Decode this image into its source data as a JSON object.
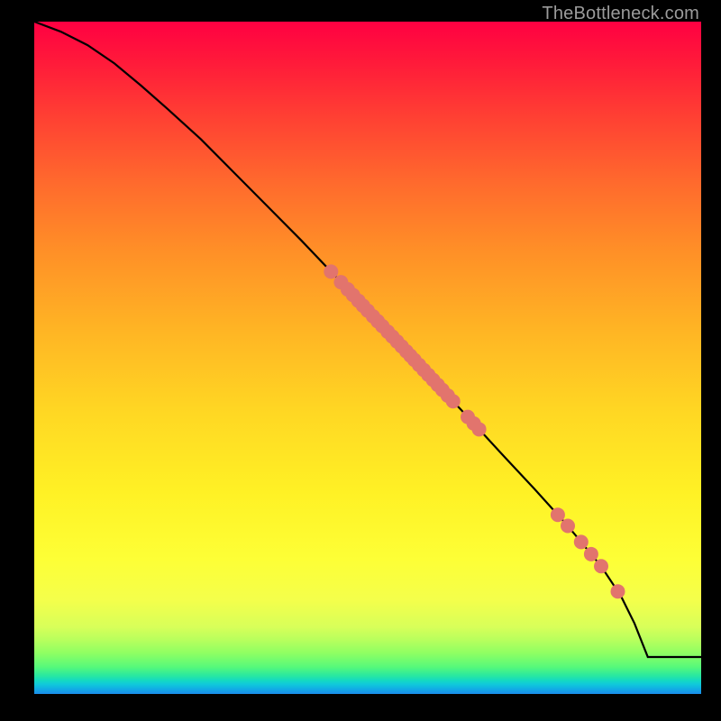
{
  "watermark": "TheBottleneck.com",
  "colors": {
    "marker": "#e2746d",
    "curve": "#000000"
  },
  "chart_data": {
    "type": "line",
    "title": "",
    "xlabel": "",
    "ylabel": "",
    "xlim": [
      0,
      100
    ],
    "ylim": [
      0,
      100
    ],
    "grid": false,
    "curve": {
      "x": [
        0,
        4,
        8,
        12,
        16,
        20,
        25,
        30,
        35,
        40,
        45,
        50,
        55,
        60,
        65,
        70,
        75,
        80,
        85,
        88,
        90,
        92,
        100
      ],
      "y": [
        100,
        98.5,
        96.5,
        93.8,
        90.5,
        87,
        82.5,
        77.5,
        72.5,
        67.5,
        62.3,
        57,
        51.8,
        46.5,
        41.2,
        35.8,
        30.5,
        25,
        19,
        14.5,
        10.5,
        5.5,
        5.5
      ]
    },
    "markers_on_curve_x": [
      44.5,
      46.0,
      47.0,
      47.8,
      48.6,
      49.3,
      50.0,
      50.8,
      51.5,
      52.2,
      53.0,
      53.7,
      54.4,
      55.1,
      55.8,
      56.4,
      57.0,
      57.7,
      58.4,
      59.1,
      59.8,
      60.5,
      61.2,
      62.0,
      62.8,
      65.0,
      65.9,
      66.7,
      78.5,
      80.0,
      82.0,
      83.5,
      85.0,
      87.5
    ],
    "marker_radius": 8
  }
}
